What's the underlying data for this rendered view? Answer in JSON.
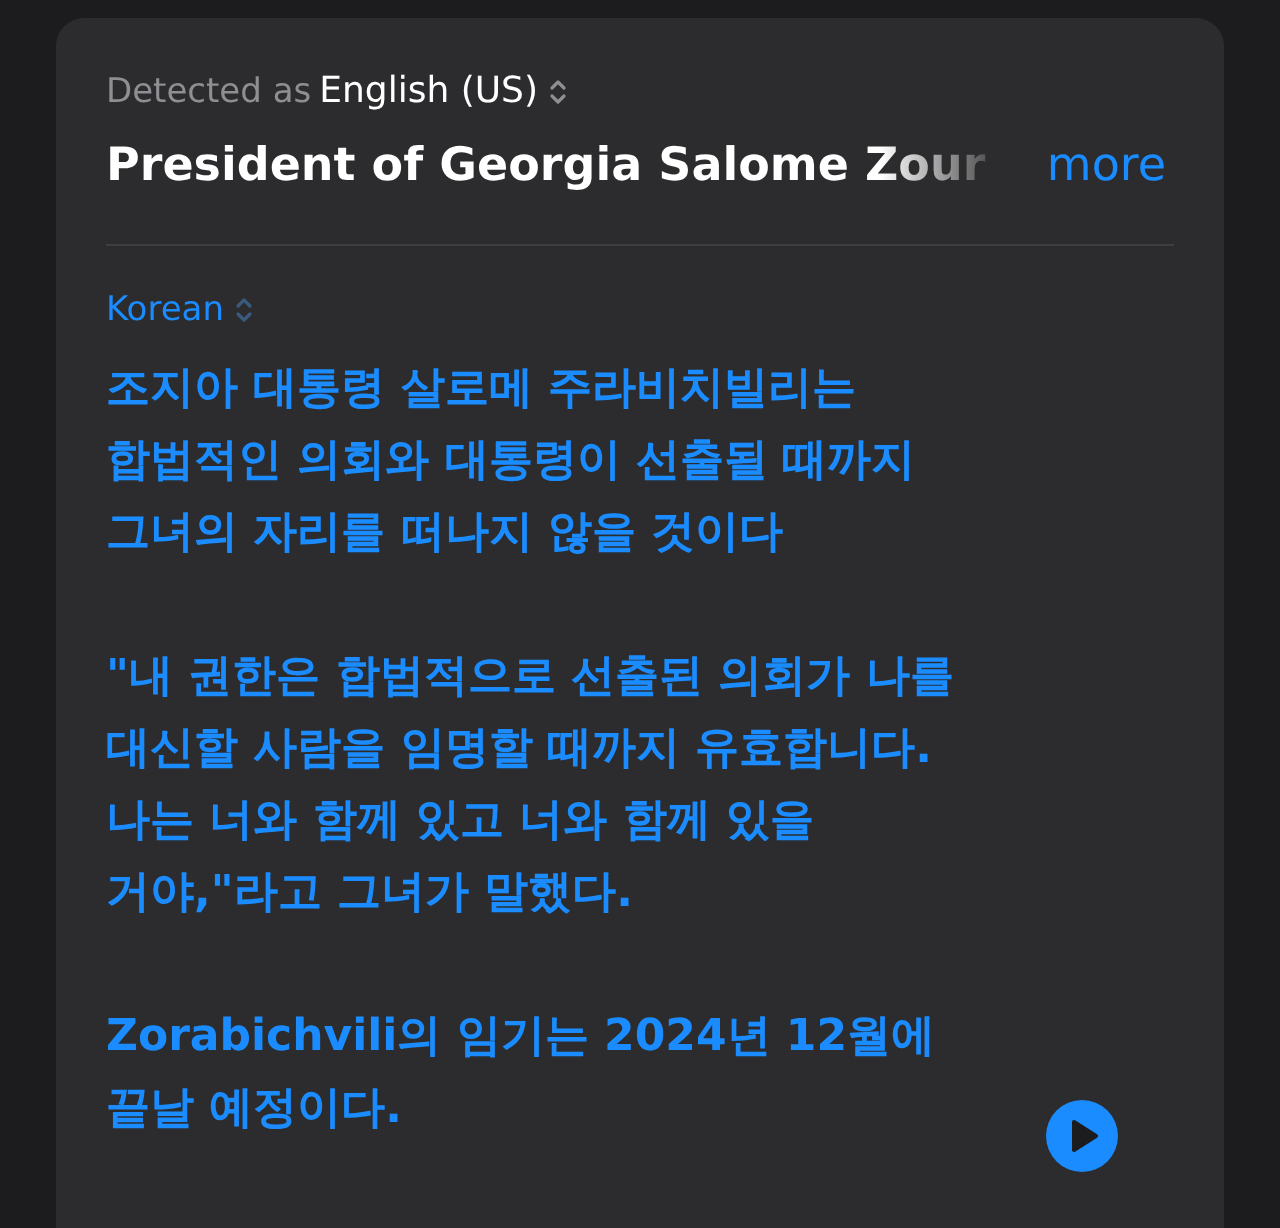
{
  "source": {
    "detected_label": "Detected as",
    "language": "English (US)",
    "text": "President of Georgia Salome Zour",
    "more": "more"
  },
  "target": {
    "language": "Korean",
    "paragraphs": [
      [
        "조지아 대통령 살로메 주라비치빌리는",
        "합법적인 의회와 대통령이 선출될 때까지",
        "그녀의 자리를 떠나지 않을 것이다"
      ],
      [
        "\"내 권한은 합법적으로 선출된 의회가 나를",
        "대신할 사람을 임명할 때까지 유효합니다.",
        "나는 너와 함께 있고 너와 함께 있을",
        "거야,\"라고 그녀가 말했다."
      ],
      [
        "Zorabichvili의 임기는 2024년 12월에",
        "끝날 예정이다."
      ]
    ]
  }
}
